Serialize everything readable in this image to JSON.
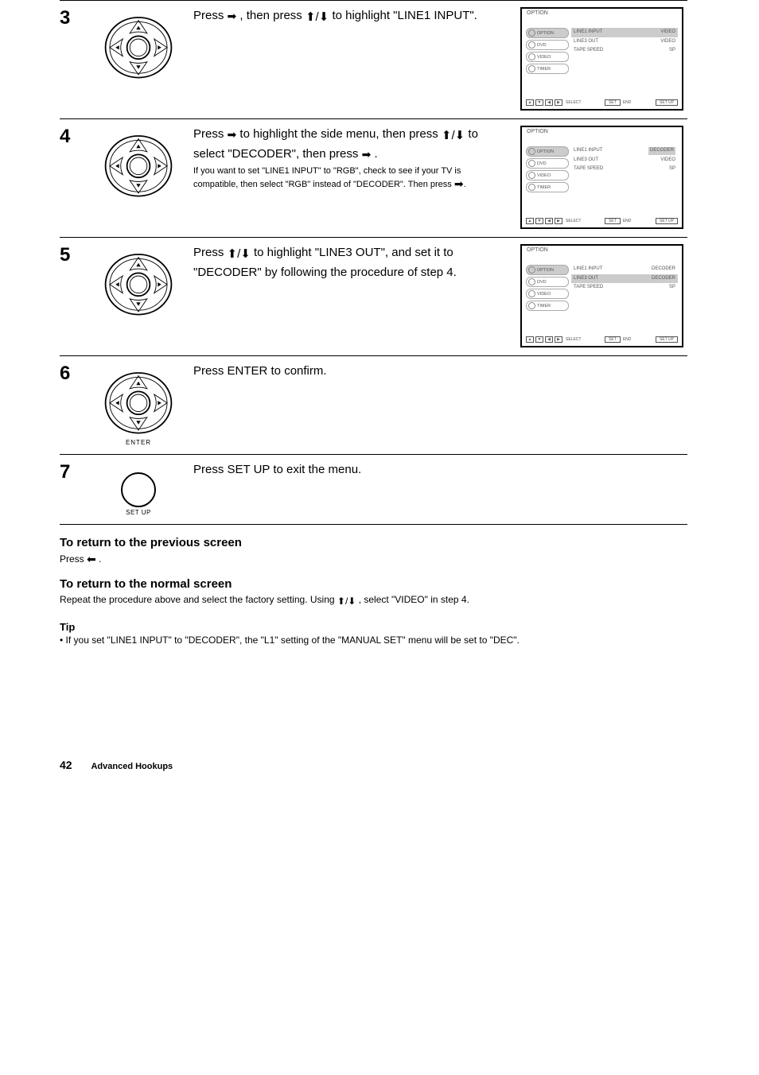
{
  "steps": [
    {
      "num": "3",
      "text_before_first_arrow": "Press ",
      "text_after_first_arrow": ", then press ",
      "text_after_updn": " to highlight \"LINE1 INPUT\".",
      "tv": {
        "title_left": "OPTION",
        "menu": [
          "OPTION",
          "DVD",
          "VIDEO",
          "TIMER"
        ],
        "sel": 0,
        "rows": [
          {
            "l": "LINE1 INPUT",
            "r": "VIDEO",
            "hl": true
          },
          {
            "l": "LINE3 OUT",
            "r": "VIDEO"
          },
          {
            "l": "TAPE SPEED",
            "r": "SP"
          }
        ]
      }
    },
    {
      "num": "4",
      "text_a": "Press ",
      "text_b": " to highlight the side menu, then press ",
      "text_c": " to select \"DECODER\", then press ",
      "text_d": ".",
      "tiny": "If you want to set \"LINE1 INPUT\" to \"RGB\", check to see if your TV is compatible, then select \"RGB\" instead of \"DECODER\". Then press .",
      "tv": {
        "title_left": "OPTION",
        "menu": [
          "OPTION",
          "DVD",
          "VIDEO",
          "TIMER"
        ],
        "sel": 0,
        "rows": [
          {
            "l": "LINE1 INPUT",
            "r": "DECODER",
            "hl_right": true
          },
          {
            "l": "LINE3 OUT",
            "r": "VIDEO"
          },
          {
            "l": "TAPE SPEED",
            "r": "SP"
          }
        ]
      }
    },
    {
      "num": "5",
      "text_a": "Press ",
      "text_b": " to highlight \"LINE3 OUT\", and set it to \"DECODER\" by following the procedure of step 4.",
      "tv": {
        "title_left": "OPTION",
        "menu": [
          "OPTION",
          "DVD",
          "VIDEO",
          "TIMER"
        ],
        "sel": 0,
        "rows": [
          {
            "l": "LINE1 INPUT",
            "r": "DECODER"
          },
          {
            "l": "LINE3 OUT",
            "r": "DECODER",
            "hl": true
          },
          {
            "l": "TAPE SPEED",
            "r": "SP"
          }
        ]
      }
    },
    {
      "num": "6",
      "text": "Press ENTER to confirm."
    },
    {
      "num": "7",
      "text": "Press SET UP to exit the menu."
    }
  ],
  "post": {
    "h1": "To return to the previous screen",
    "p1a": "Press ",
    "p1b": ".",
    "h2": "To return to the normal screen",
    "p2a": "Repeat the procedure above and select the factory setting. Using ",
    "p2b": ", select \"VIDEO\" in step 4."
  },
  "tip": {
    "label": "Tip",
    "text": "• If you set \"LINE1 INPUT\" to \"DECODER\", the \"L1\" setting of the \"MANUAL SET\" menu will be set to \"DEC\"."
  },
  "page_number": "42",
  "page_footer": "Advanced Hookups",
  "nav_footer": {
    "select": "SELECT",
    "set": "SET",
    "end": "END",
    "setup": "SET UP"
  }
}
